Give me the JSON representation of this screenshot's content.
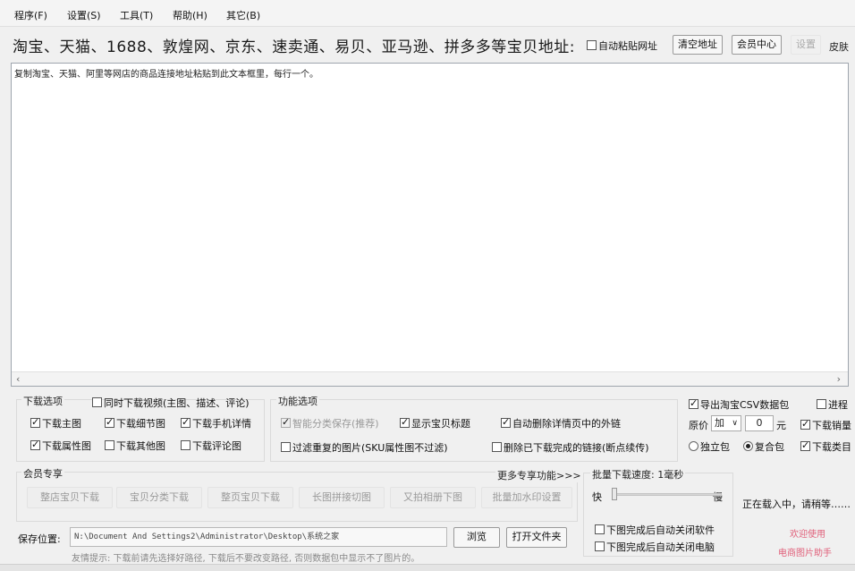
{
  "menu": [
    "程序(F)",
    "设置(S)",
    "工具(T)",
    "帮助(H)",
    "其它(B)"
  ],
  "header": {
    "sites_label": "淘宝、天猫、1688、敦煌网、京东、速卖通、易贝、亚马逊、拼多多等宝贝地址:",
    "auto_paste": "自动粘贴网址",
    "clear_button": "清空地址",
    "member_button": "会员中心",
    "settings_button": "设置",
    "skin_button": "皮肤"
  },
  "url_area": {
    "hint": "复制淘宝、天猫、阿里等网店的商品连接地址粘贴到此文本框里，每行一个。"
  },
  "download_options": {
    "title": "下载选项",
    "video": "同时下载视频(主图、描述、评论)",
    "items": [
      {
        "label": "下载主图",
        "checked": true
      },
      {
        "label": "下载细节图",
        "checked": true
      },
      {
        "label": "下载手机详情",
        "checked": true
      },
      {
        "label": "下载属性图",
        "checked": true
      },
      {
        "label": "下载其他图",
        "checked": false
      },
      {
        "label": "下载评论图",
        "checked": false
      }
    ]
  },
  "feature_options": {
    "title": "功能选项",
    "smart_save": "智能分类保存(推荐)",
    "show_title": "显示宝贝标题",
    "auto_remove_links": "自动删除详情页中的外链",
    "filter_dup": "过滤重复的图片(SKU属性图不过滤)",
    "delete_done": "删除已下载完成的链接(断点续传)"
  },
  "right_options": {
    "export_csv": "导出淘宝CSV数据包",
    "process": "进程",
    "price_label": "原价",
    "price_op": "加",
    "price_value": "0",
    "price_unit": "元",
    "download_sales": "下载销量",
    "standalone": "独立包",
    "combined": "复合包",
    "download_cat": "下载类目"
  },
  "member": {
    "title": "会员专享",
    "more": "更多专享功能>>>",
    "buttons": [
      "整店宝贝下载",
      "宝贝分类下载",
      "整页宝贝下载",
      "长图拼接切图",
      "又拍相册下图",
      "批量加水印设置"
    ]
  },
  "speed": {
    "title": "批量下载速度: 1毫秒",
    "fast": "快",
    "slow": "慢",
    "close_app": "下图完成后自动关闭软件",
    "shutdown": "下图完成后自动关闭电脑",
    "level": 0.0
  },
  "status": {
    "loading": "正在载入中，请稍等……",
    "welcome": "欢迎使用",
    "app_name": "电商图片助手"
  },
  "save": {
    "label": "保存位置:",
    "path": "N:\\Document And Settings2\\Administrator\\Desktop\\系统之家",
    "browse": "浏览",
    "open_folder": "打开文件夹",
    "tip": "友情提示: 下载前请先选择好路径, 下载后不要改变路径, 否则数据包中显示不了图片的。"
  }
}
